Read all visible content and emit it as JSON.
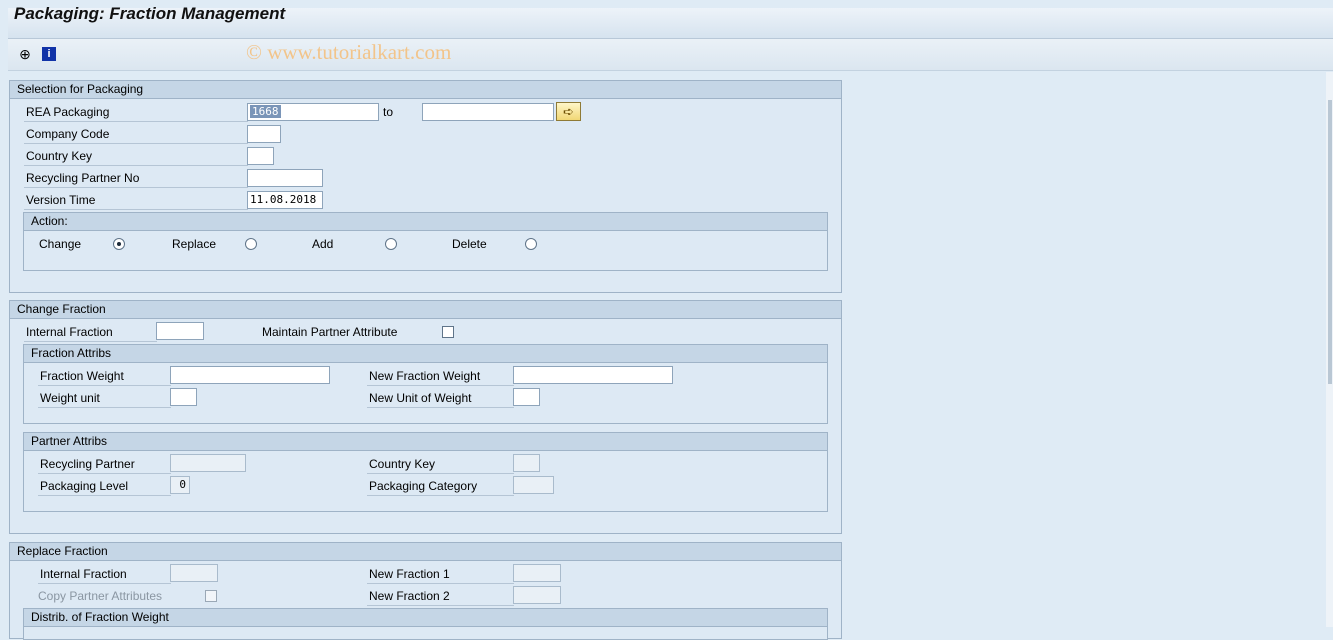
{
  "window": {
    "title": "Packaging: Fraction Management"
  },
  "toolbar": {
    "icons": [
      "execute-icon",
      "info-icon"
    ],
    "execute_glyph": "⊕",
    "info_glyph": "i"
  },
  "watermark": "© www.tutorialkart.com",
  "selection": {
    "title": "Selection for Packaging",
    "rea_packaging_label": "REA Packaging",
    "rea_packaging_from": "1668",
    "to_label": "to",
    "rea_packaging_to": "",
    "company_code_label": "Company Code",
    "company_code": "",
    "country_key_label": "Country Key",
    "country_key": "",
    "recycling_partner_no_label": "Recycling Partner No",
    "recycling_partner_no": "",
    "version_time_label": "Version Time",
    "version_time": "11.08.2018",
    "action": {
      "title": "Action:",
      "options": [
        {
          "label": "Change",
          "selected": true
        },
        {
          "label": "Replace",
          "selected": false
        },
        {
          "label": "Add",
          "selected": false
        },
        {
          "label": "Delete",
          "selected": false
        }
      ]
    }
  },
  "change_fraction": {
    "title": "Change Fraction",
    "internal_fraction_label": "Internal Fraction",
    "internal_fraction": "",
    "maintain_partner_label": "Maintain Partner Attribute",
    "maintain_partner_checked": false,
    "fraction_attribs": {
      "title": "Fraction Attribs",
      "fraction_weight_label": "Fraction Weight",
      "fraction_weight": "",
      "new_fraction_weight_label": "New Fraction Weight",
      "new_fraction_weight": "",
      "weight_unit_label": "Weight unit",
      "weight_unit": "",
      "new_unit_label": "New Unit of Weight",
      "new_unit": ""
    },
    "partner_attribs": {
      "title": "Partner Attribs",
      "recycling_partner_label": "Recycling Partner",
      "recycling_partner": "",
      "country_key_label": "Country Key",
      "country_key": "",
      "packaging_level_label": "Packaging Level",
      "packaging_level": "0",
      "packaging_category_label": "Packaging Category",
      "packaging_category": ""
    }
  },
  "replace_fraction": {
    "title": "Replace Fraction",
    "internal_fraction_label": "Internal Fraction",
    "internal_fraction": "",
    "new_fraction_1_label": "New Fraction 1",
    "new_fraction_1": "",
    "copy_partner_label": "Copy Partner Attributes",
    "copy_partner_checked": false,
    "new_fraction_2_label": "New Fraction 2",
    "new_fraction_2": "",
    "distrib_title": "Distrib. of Fraction Weight"
  }
}
